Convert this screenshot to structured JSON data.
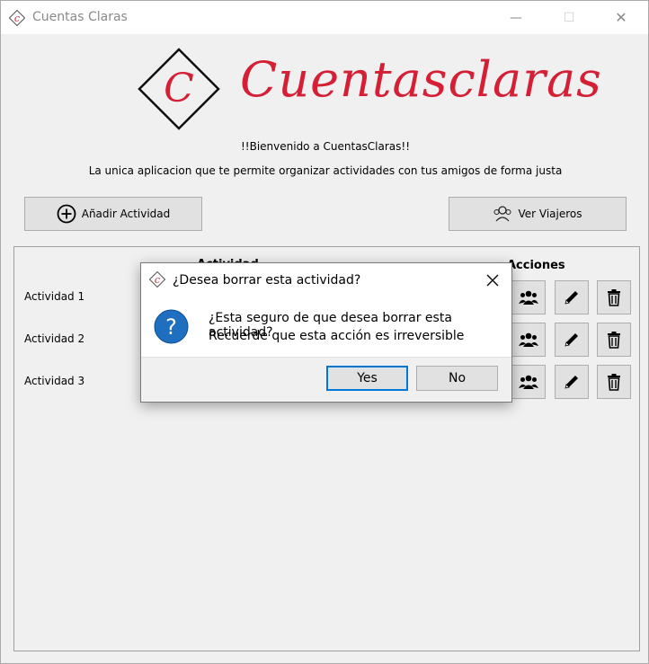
{
  "window": {
    "title": "Cuentas Claras",
    "minimize_glyph": "—",
    "maximize_glyph": "☐",
    "close_glyph": "✕"
  },
  "header": {
    "logo_letter": "C",
    "wordmark": "Cuentasclaras",
    "welcome": "!!Bienvenido a CuentasClaras!!",
    "subtitle": "La unica aplicacion que te permite organizar actividades con tus amigos de forma justa"
  },
  "toolbar": {
    "add_activity_label": "Añadir Actividad",
    "add_icon": "plus-circle-icon",
    "travelers_label": "Ver Viajeros",
    "travelers_icon": "people-icon"
  },
  "table": {
    "columns": [
      "Actividad",
      "Acciones"
    ],
    "rows": [
      {
        "label": "Actividad 1"
      },
      {
        "label": "Actividad 2"
      },
      {
        "label": "Actividad 3"
      }
    ],
    "row_actions": [
      "group-icon",
      "pencil-icon",
      "trash-icon"
    ]
  },
  "dialog": {
    "title": "¿Desea borrar esta actividad?",
    "message_line1": "¿Esta seguro de que desea borrar esta actividad?",
    "message_line2": "Recuerde que esta acción es irreversible",
    "icon": "question-icon",
    "yes_label": "Yes",
    "no_label": "No"
  },
  "colors": {
    "brand_red": "#d51f35",
    "question_blue": "#1e6fbf",
    "focus_blue": "#0078d7"
  }
}
